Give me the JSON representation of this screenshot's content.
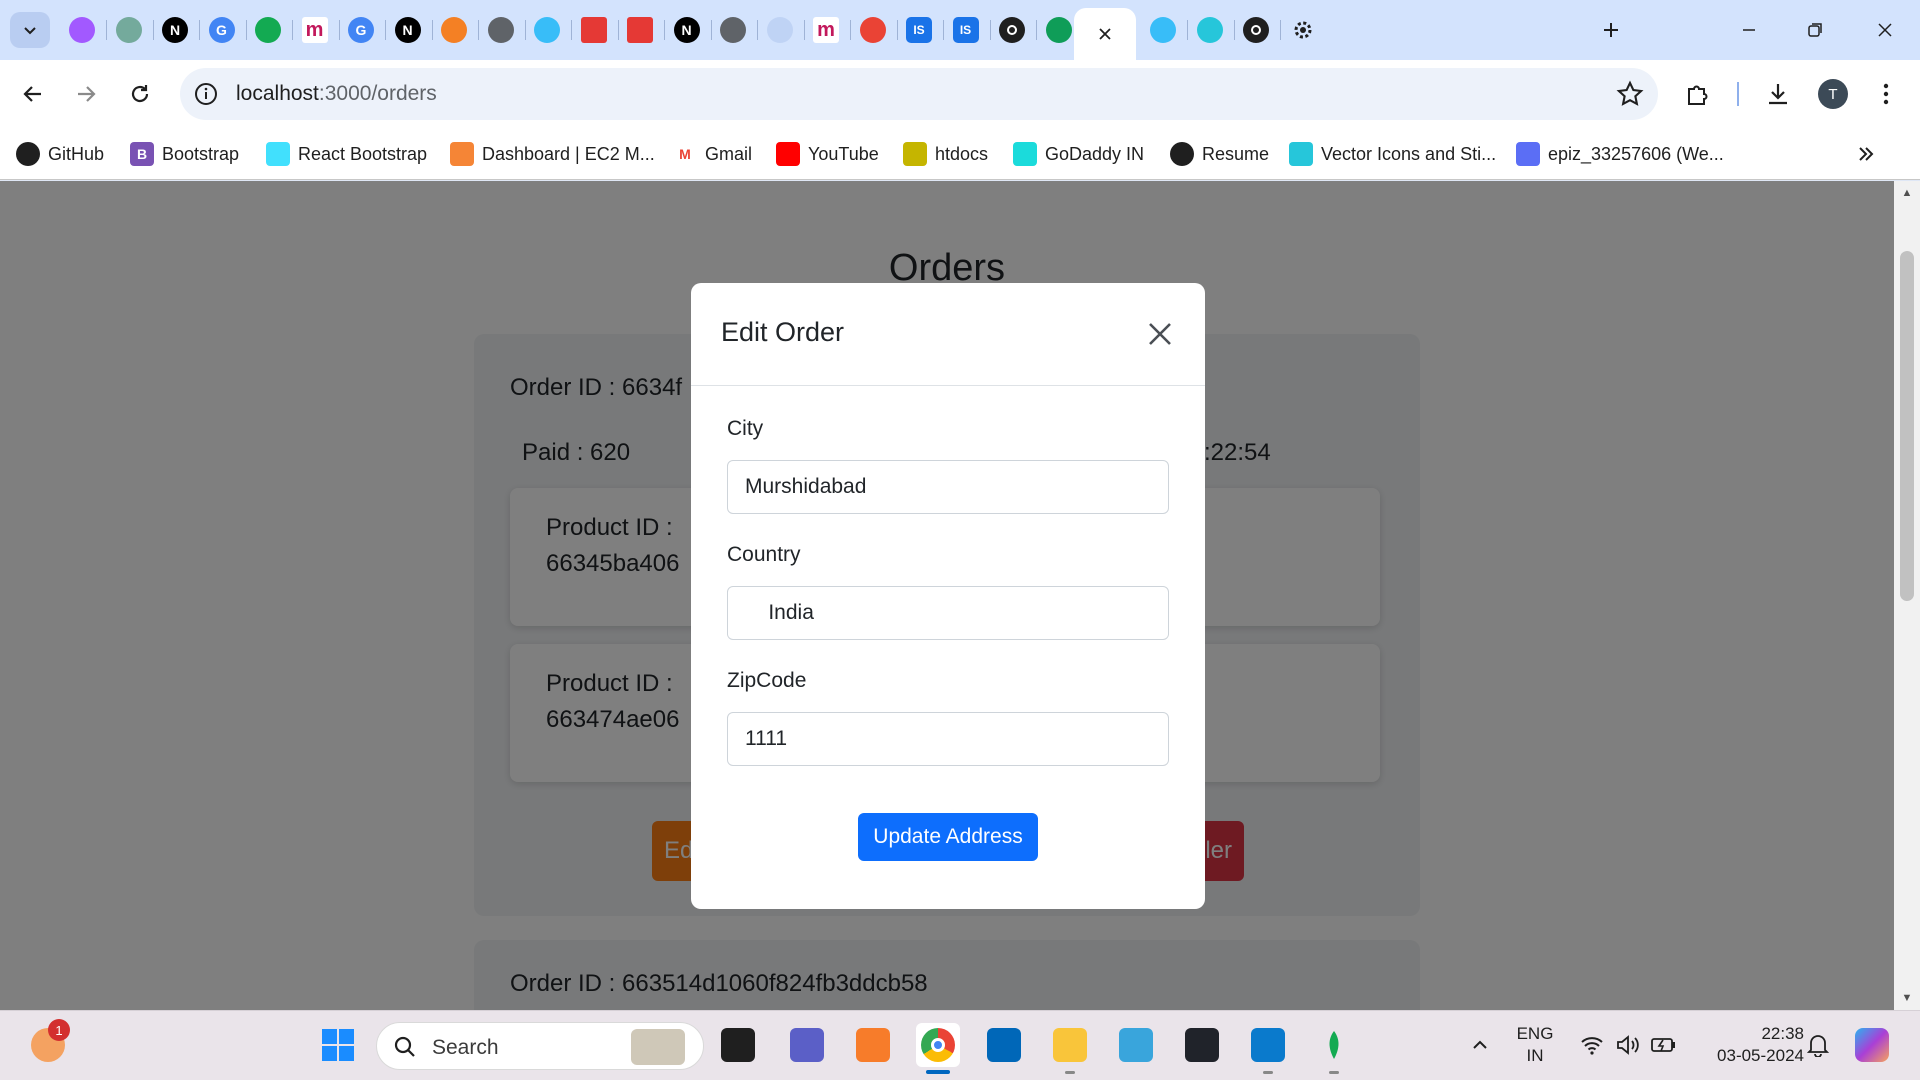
{
  "browser": {
    "url_host": "localhost",
    "url_path": ":3000/orders",
    "profile_initial": "T",
    "tabs": [
      {
        "icon": "chrome-tab-search-icon"
      },
      {
        "icon": "figma-like-icon",
        "color": "#a259ff"
      },
      {
        "icon": "chatgpt-icon",
        "color": "#74aa9c"
      },
      {
        "icon": "nextjs-icon",
        "color": "#000000",
        "glyph": "N"
      },
      {
        "icon": "google-icon",
        "color": "#4285f4",
        "glyph": "G"
      },
      {
        "icon": "mongodb-icon",
        "color": "#13aa52"
      },
      {
        "icon": "medium-icon",
        "color": "#c2185b",
        "glyph": "m"
      },
      {
        "icon": "google-icon",
        "color": "#4285f4",
        "glyph": "G"
      },
      {
        "icon": "nextjs-icon",
        "color": "#000000",
        "glyph": "N"
      },
      {
        "icon": "stackoverflow-icon",
        "color": "#f48024"
      },
      {
        "icon": "globe-icon",
        "color": "#5f6368"
      },
      {
        "icon": "tailwind-icon",
        "color": "#38bdf8"
      },
      {
        "icon": "notion-red-icon",
        "color": "#e53935"
      },
      {
        "icon": "notion-red-icon",
        "color": "#e53935"
      },
      {
        "icon": "nextjs-icon",
        "color": "#000000",
        "glyph": "N"
      },
      {
        "icon": "globe-icon",
        "color": "#5f6368"
      },
      {
        "icon": "blank-page-icon",
        "color": "#bfd3f5"
      },
      {
        "icon": "medium-icon",
        "color": "#c2185b",
        "glyph": "m"
      },
      {
        "icon": "gmail-icon",
        "color": "#ea4335"
      },
      {
        "icon": "is-icon",
        "color": "#1a73e8",
        "glyph": "IS"
      },
      {
        "icon": "is-icon",
        "color": "#1a73e8",
        "glyph": "IS"
      },
      {
        "icon": "github-icon",
        "color": "#1f1f1f"
      },
      {
        "icon": "feather-icon",
        "color": "#0f9d58"
      },
      {
        "icon": "close-icon",
        "color": "#1f1f1f"
      },
      {
        "icon": "tailwind-icon",
        "color": "#38bdf8"
      },
      {
        "icon": "vector-icon",
        "color": "#26c6da"
      },
      {
        "icon": "github-icon",
        "color": "#1f1f1f"
      },
      {
        "icon": "gear-icon",
        "color": "#1f1f1f"
      }
    ],
    "bookmarks": [
      {
        "label": "GitHub",
        "icon": "github-icon",
        "color": "#1f1f1f"
      },
      {
        "label": "Bootstrap",
        "icon": "bootstrap-icon",
        "color": "#7952b3"
      },
      {
        "label": "React Bootstrap",
        "icon": "react-bootstrap-icon",
        "color": "#41e0fd"
      },
      {
        "label": "Dashboard | EC2 M...",
        "icon": "aws-icon",
        "color": "#f58536"
      },
      {
        "label": "Gmail",
        "icon": "gmail-icon",
        "color": "#ea4335"
      },
      {
        "label": "YouTube",
        "icon": "youtube-icon",
        "color": "#ff0000"
      },
      {
        "label": "htdocs",
        "icon": "htdocs-icon",
        "color": "#c5b500"
      },
      {
        "label": "GoDaddy IN",
        "icon": "godaddy-icon",
        "color": "#1bdbdb"
      },
      {
        "label": "Resume",
        "icon": "globe-icon",
        "color": "#1f1f1f"
      },
      {
        "label": "Vector Icons and Sti...",
        "icon": "vector-icon",
        "color": "#26c6da"
      },
      {
        "label": "epiz_33257606 (We...",
        "icon": "infinity-icon",
        "color": "#5b6ef5"
      }
    ]
  },
  "page": {
    "title": "Orders",
    "order1": {
      "id_text": "Order ID : 6634f",
      "paid_text": "Paid : 620",
      "date_fragment": ":22:54",
      "products": [
        {
          "label": "Product ID :",
          "id": "66345ba406"
        },
        {
          "label": "Product ID :",
          "id": "663474ae06"
        }
      ],
      "edit_fragment": "Ed",
      "cancel_fragment": "ler"
    },
    "order2": {
      "id_text": "Order ID : 663514d1060f824fb3ddcb58"
    }
  },
  "modal": {
    "title": "Edit Order",
    "fields": [
      {
        "label": "City",
        "value": "Murshidabad"
      },
      {
        "label": "Country",
        "value": "    India"
      },
      {
        "label": "ZipCode",
        "value": "1111"
      }
    ],
    "submit_label": "Update Address"
  },
  "taskbar": {
    "search_placeholder": "Search",
    "notification_count": "1",
    "lang_line1": "ENG",
    "lang_line2": "IN",
    "time": "22:38",
    "date": "03-05-2024",
    "colors": {
      "accent": "#0d6efd",
      "edit": "#fd7e14",
      "danger": "#dc3545"
    }
  }
}
